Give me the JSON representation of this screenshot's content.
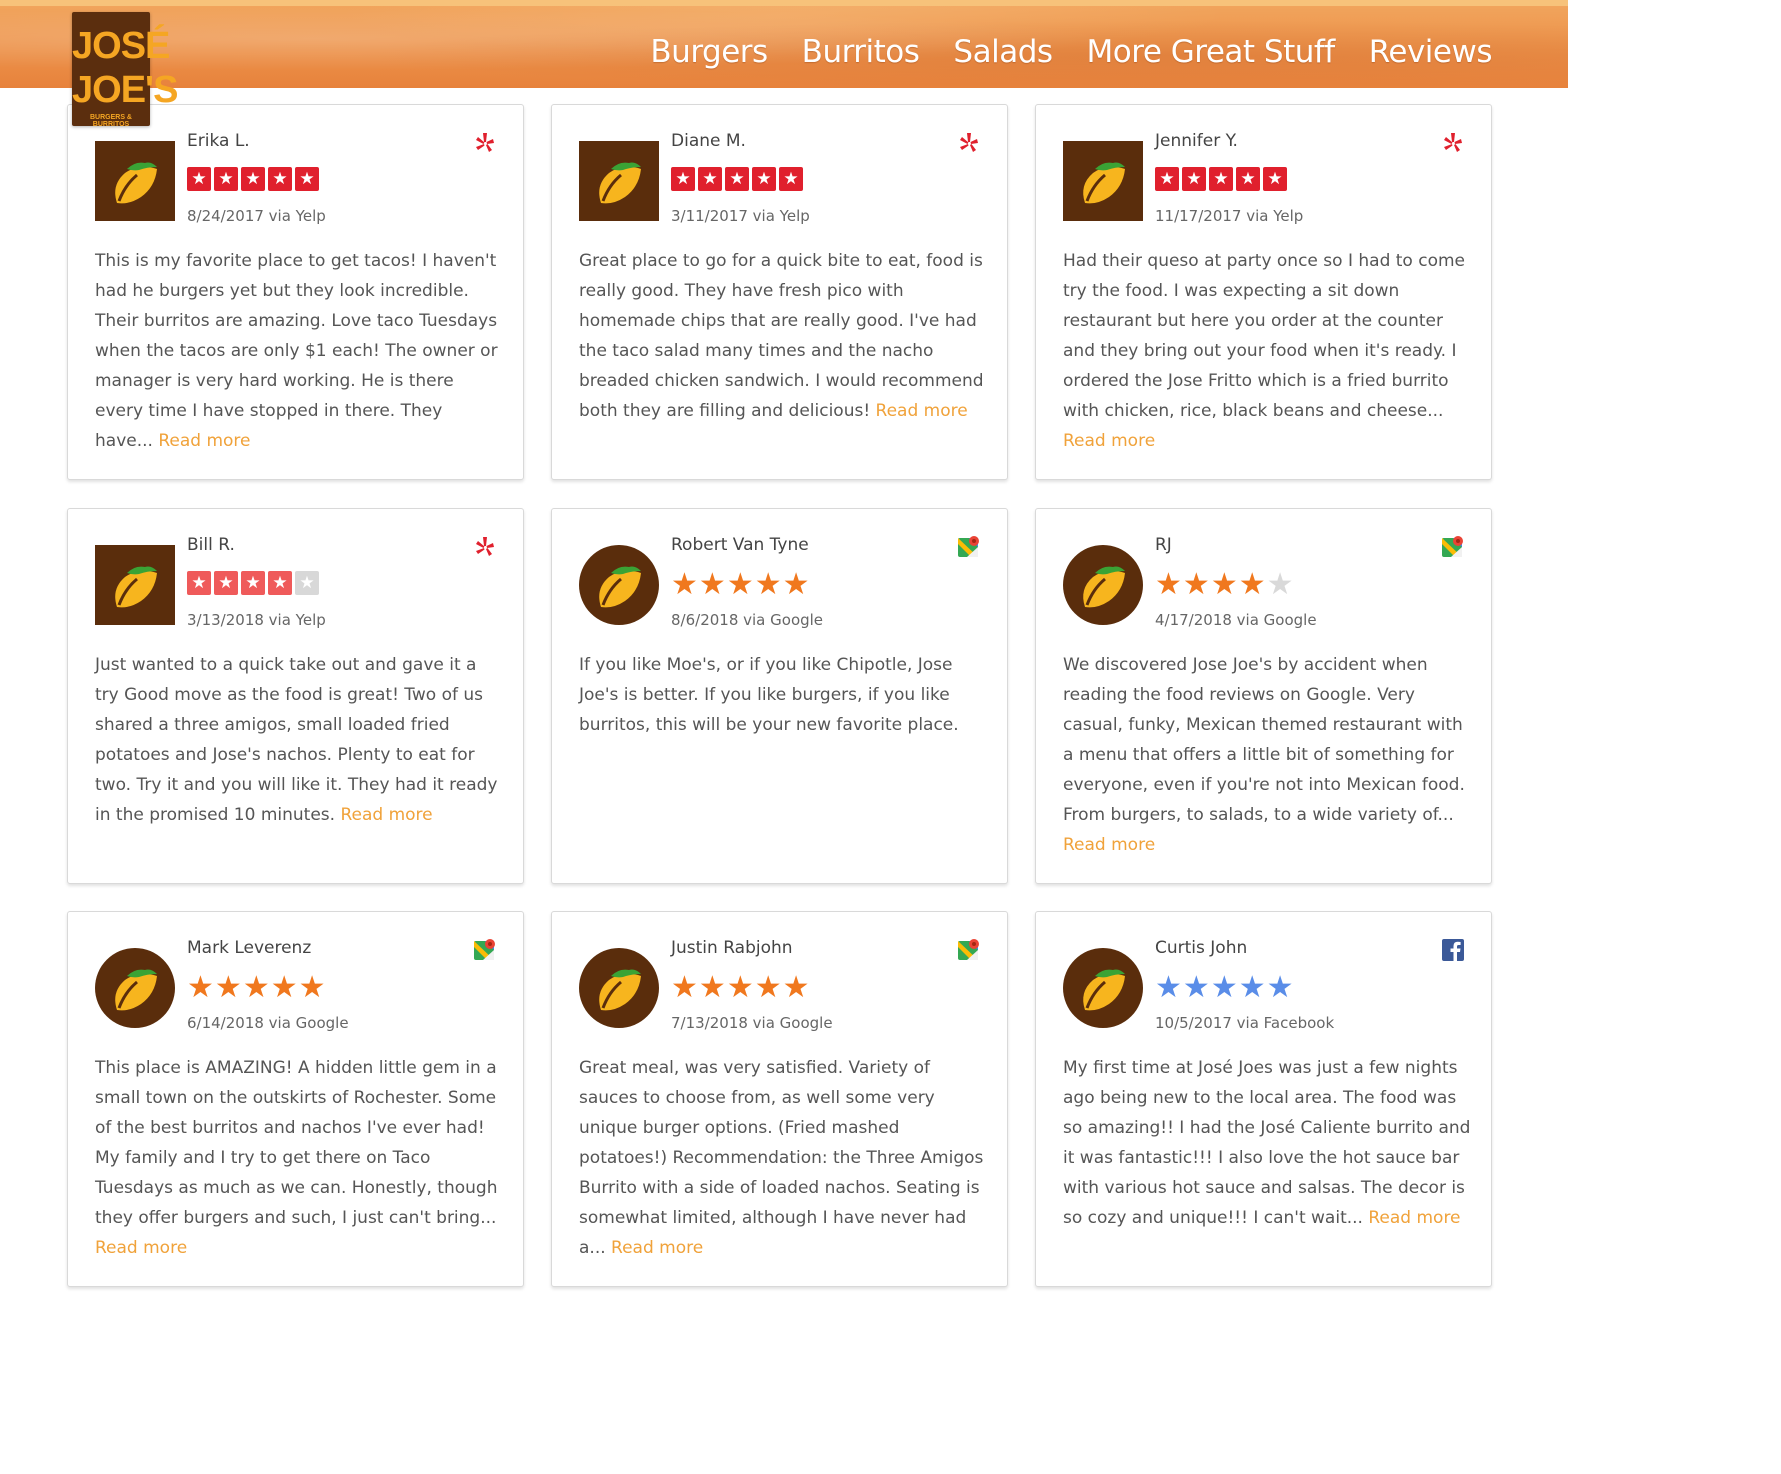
{
  "brand": {
    "line1": "JOSÉ",
    "line2": "JOE'S",
    "tagline": "BURGERS & BURRITOS"
  },
  "nav": [
    {
      "label": "Burgers"
    },
    {
      "label": "Burritos"
    },
    {
      "label": "Salads"
    },
    {
      "label": "More Great Stuff"
    },
    {
      "label": "Reviews"
    }
  ],
  "colors": {
    "yelp_red": "#e0202d",
    "google_star": "#f0781e",
    "facebook_star": "#5a8de8",
    "read_more": "#f0a23a",
    "avatar_bg": "#5a2d0c"
  },
  "read_more_label": "Read more",
  "reviews": [
    {
      "name": "Erika L.",
      "source": "yelp",
      "source_icon": "yelp-icon",
      "rating": 5,
      "date": "8/24/2017 via Yelp",
      "text": "This is my favorite place to get tacos! I haven't had he burgers yet but they look incredible. Their burritos are amazing. Love taco Tuesdays when the tacos are only $1 each! The owner or manager is very hard working. He is there every time I have stopped in there. They have... "
    },
    {
      "name": "Diane M.",
      "source": "yelp",
      "source_icon": "yelp-icon",
      "rating": 5,
      "date": "3/11/2017 via Yelp",
      "text": "Great place to go for a quick bite to eat, food is really good. They have fresh pico with homemade chips that are really good. I've had the taco salad many times and the nacho breaded chicken sandwich. I would recommend both they are filling and delicious! "
    },
    {
      "name": "Jennifer Y.",
      "source": "yelp",
      "source_icon": "yelp-icon",
      "rating": 5,
      "date": "11/17/2017 via Yelp",
      "text": "Had their queso at party once so I had to come try the food. I was expecting a sit down restaurant but here you order at the counter and they bring out your food when it's ready. I ordered the Jose Fritto which is a fried burrito with chicken, rice, black beans and cheese... "
    },
    {
      "name": "Bill R.",
      "source": "yelp",
      "source_icon": "yelp-icon",
      "rating": 4,
      "date": "3/13/2018 via Yelp",
      "text": "Just wanted to a quick take out and gave it a try Good move as the food is great! Two of us shared a three amigos, small loaded fried potatoes and Jose's nachos. Plenty to eat for two. Try it and you will like it. They had it ready in the promised 10 minutes. "
    },
    {
      "name": "Robert Van Tyne",
      "source": "google",
      "source_icon": "google-maps-icon",
      "rating": 5,
      "date": "8/6/2018 via Google",
      "text": "If you like Moe's, or if you like Chipotle, Jose Joe's is better. If you like burgers, if you like burritos, this will be your new favorite place.",
      "read_more": false
    },
    {
      "name": "RJ",
      "source": "google",
      "source_icon": "google-maps-icon",
      "rating": 4,
      "date": "4/17/2018 via Google",
      "text": "We discovered Jose Joe's by accident when reading the food reviews on Google. Very casual, funky, Mexican themed restaurant with a menu that offers a little bit of something for everyone, even if you're not into Mexican food. From burgers, to salads, to a wide variety of... "
    },
    {
      "name": "Mark Leverenz",
      "source": "google",
      "source_icon": "google-maps-icon",
      "rating": 5,
      "date": "6/14/2018 via Google",
      "text": "This place is AMAZING! A hidden little gem in a small town on the outskirts of Rochester. Some of the best burritos and nachos I've ever had! My family and I try to get there on Taco Tuesdays as much as we can. Honestly, though they offer burgers and such, I just can't bring... "
    },
    {
      "name": "Justin Rabjohn",
      "source": "google",
      "source_icon": "google-maps-icon",
      "rating": 5,
      "date": "7/13/2018 via Google",
      "text": "Great meal, was very satisfied. Variety of sauces to choose from, as well some very unique burger options. (Fried mashed potatoes!) Recommendation: the Three Amigos Burrito with a side of loaded nachos. Seating is somewhat limited, although I have never had a... "
    },
    {
      "name": "Curtis John",
      "source": "facebook",
      "source_icon": "facebook-icon",
      "rating": 5,
      "date": "10/5/2017 via Facebook",
      "text": "My first time at José Joes was just a few nights ago being new to the local area. The food was so amazing!! I had the José Caliente burrito and it was fantastic!!! I also love the hot sauce bar with various hot sauce and salsas. The decor is so cozy and unique!!! I can't wait... "
    }
  ]
}
